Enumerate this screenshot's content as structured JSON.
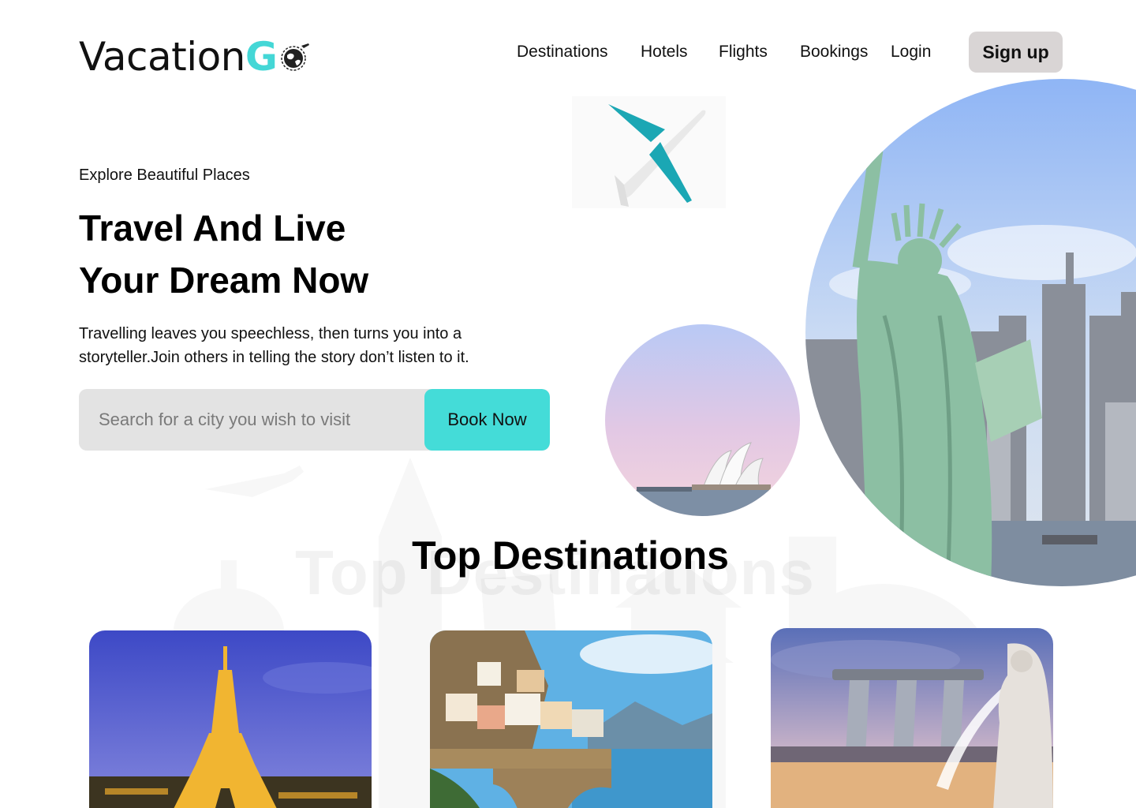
{
  "brand": {
    "name_main": "Vacation",
    "name_accent": "G",
    "accent_color": "#44d7d6",
    "globe_icon": "globe-plane-icon"
  },
  "nav": {
    "items": [
      {
        "label": "Destinations"
      },
      {
        "label": "Hotels"
      },
      {
        "label": "Flights"
      },
      {
        "label": "Bookings"
      },
      {
        "label": "Login"
      }
    ],
    "signup_label": "Sign up"
  },
  "hero": {
    "eyebrow": "Explore Beautiful Places",
    "title_line1": "Travel And Live",
    "title_line2": "Your Dream Now",
    "description": "Travelling leaves you speechless, then turns you into a storyteller.Join others in telling the story don’t listen to it."
  },
  "search": {
    "placeholder": "Search for a city you wish to visit",
    "value": "",
    "button_label": "Book Now",
    "button_color": "#44dcd8"
  },
  "destinations": {
    "title": "Top Destinations",
    "cards": [
      {
        "image": "eiffel-tower-photo"
      },
      {
        "image": "amalfi-coast-photo"
      },
      {
        "image": "marina-bay-sands-photo"
      }
    ]
  }
}
